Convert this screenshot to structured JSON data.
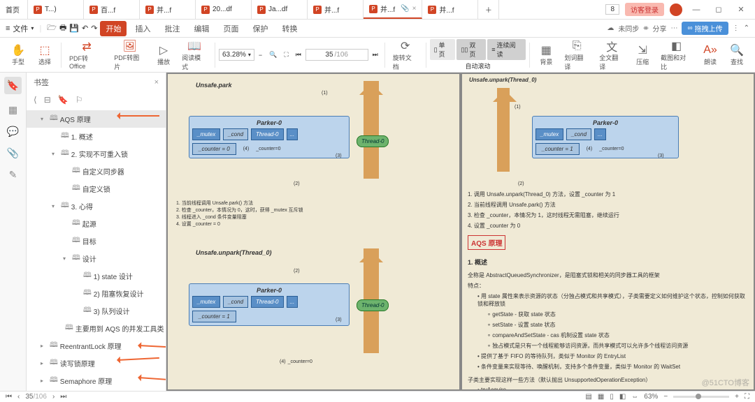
{
  "tabs": {
    "home": "首页",
    "t1": "T...)",
    "t2": "百...f",
    "t3": "并...f",
    "t4": "20...df",
    "t5": "Ja...df",
    "t6": "并...f",
    "active": "并...f",
    "t8": "并...f",
    "badge": "8",
    "login": "访客登录"
  },
  "menu": {
    "file": "文件",
    "start": "开始",
    "insert": "插入",
    "review": "批注",
    "edit": "编辑",
    "page": "页面",
    "protect": "保护",
    "convert": "转换",
    "sync": "未同步",
    "share": "分享",
    "upload": "拖拽上传"
  },
  "toolbar": {
    "hand": "手型",
    "select": "选择",
    "pdf2office": "PDF转Office",
    "pdf2img": "PDF转图片",
    "play": "播放",
    "readmode": "阅读模式",
    "zoom": "63.28%",
    "page_cur": "35",
    "page_total": "/106",
    "rotate": "旋转文档",
    "single": "单页",
    "double": "双页",
    "continuous": "连续阅读",
    "autoscroll": "自动滚动",
    "bg": "背景",
    "fulltrans": "全文翻译",
    "compress": "压缩",
    "compare": "截图和对比",
    "read": "朗读",
    "find": "查找",
    "huaci": "划词翻译"
  },
  "bookmarks": {
    "title": "书签",
    "items": [
      {
        "level": 1,
        "arrow": "▾",
        "label": "AQS 原理",
        "sel": true
      },
      {
        "level": 2,
        "arrow": "",
        "label": "1. 概述"
      },
      {
        "level": 2,
        "arrow": "▾",
        "label": "2. 实现不可重入锁"
      },
      {
        "level": 3,
        "arrow": "",
        "label": "自定义同步器"
      },
      {
        "level": 3,
        "arrow": "",
        "label": "自定义锁"
      },
      {
        "level": 2,
        "arrow": "▾",
        "label": "3. 心得"
      },
      {
        "level": 3,
        "arrow": "",
        "label": "起源"
      },
      {
        "level": 3,
        "arrow": "",
        "label": "目标"
      },
      {
        "level": 3,
        "arrow": "▾",
        "label": "设计"
      },
      {
        "level": 4,
        "arrow": "",
        "label": "1) state 设计"
      },
      {
        "level": 4,
        "arrow": "",
        "label": "2) 阻塞恢复设计"
      },
      {
        "level": 4,
        "arrow": "",
        "label": "3) 队列设计"
      },
      {
        "level": 3,
        "arrow": "",
        "label": "主要用到 AQS 的并发工具类"
      },
      {
        "level": 1,
        "arrow": "▸",
        "label": "ReentrantLock 原理"
      },
      {
        "level": 1,
        "arrow": "▸",
        "label": "读写锁原理"
      },
      {
        "level": 1,
        "arrow": "▸",
        "label": "Semaphore 原理"
      }
    ]
  },
  "doc": {
    "unsafe_park": "Unsafe.park",
    "unsafe_unpark": "Unsafe.unpark(Thread_0)",
    "parker": "Parker-0",
    "mutex": "_mutex",
    "cond": "_cond",
    "thread0": "Thread-0",
    "counter0": "_counter = 0",
    "counter1": "_counter = 1",
    "n1": "(1)",
    "n2": "(2)",
    "n3": "(3)",
    "n4": "(4)",
    "counter_lbl0": "_counter=0",
    "left_notes": [
      "1. 当前线程调用 Unsafe.park() 方法",
      "2. 检查 _counter，本情况为 0，这时，获得 _mutex 互斥锁",
      "3. 线程进入 _cond 条件变量阻塞",
      "4. 设置 _counter = 0"
    ],
    "right_notes": [
      "1. 调用 Unsafe.unpark(Thread_0) 方法，设置 _counter 为 1",
      "2. 当前线程调用 Unsafe.park() 方法",
      "3. 检查 _counter，本情况为 1，这时线程无需阻塞，继续运行",
      "4. 设置 _counter 为 0"
    ],
    "h_aqs": "AQS 原理",
    "h_overview": "1. 概述",
    "overview": "全称是 AbstractQueuedSynchronizer，是阻塞式锁和相关的同步器工具的框架",
    "features": "特点：",
    "b1": "用 state 属性来表示资源的状态（分独占模式和共享模式），子类需要定义如何维护这个状态，控制如何获取锁和释放锁",
    "sb1": "getState - 获取 state 状态",
    "sb2": "setState - 设置 state 状态",
    "sb3": "compareAndSetState - cas 机制设置 state 状态",
    "sb4": "独占模式是只有一个线程能够访问资源，而共享模式可以允许多个线程访问资源",
    "b2": "提供了基于 FIFO 的等待队列，类似于 Monitor 的 EntryList",
    "b3": "条件变量来实现等待、唤醒机制，支持多个条件变量，类似于 Monitor 的 WaitSet",
    "sub2": "子类主要实现这样一些方法（默认抛出 UnsupportedOperationException）",
    "m1": "tryAcquire"
  },
  "status": {
    "page_cur": "35",
    "page_total": "/106",
    "zoom": "63%",
    "watermark": "@51CTO博客"
  }
}
